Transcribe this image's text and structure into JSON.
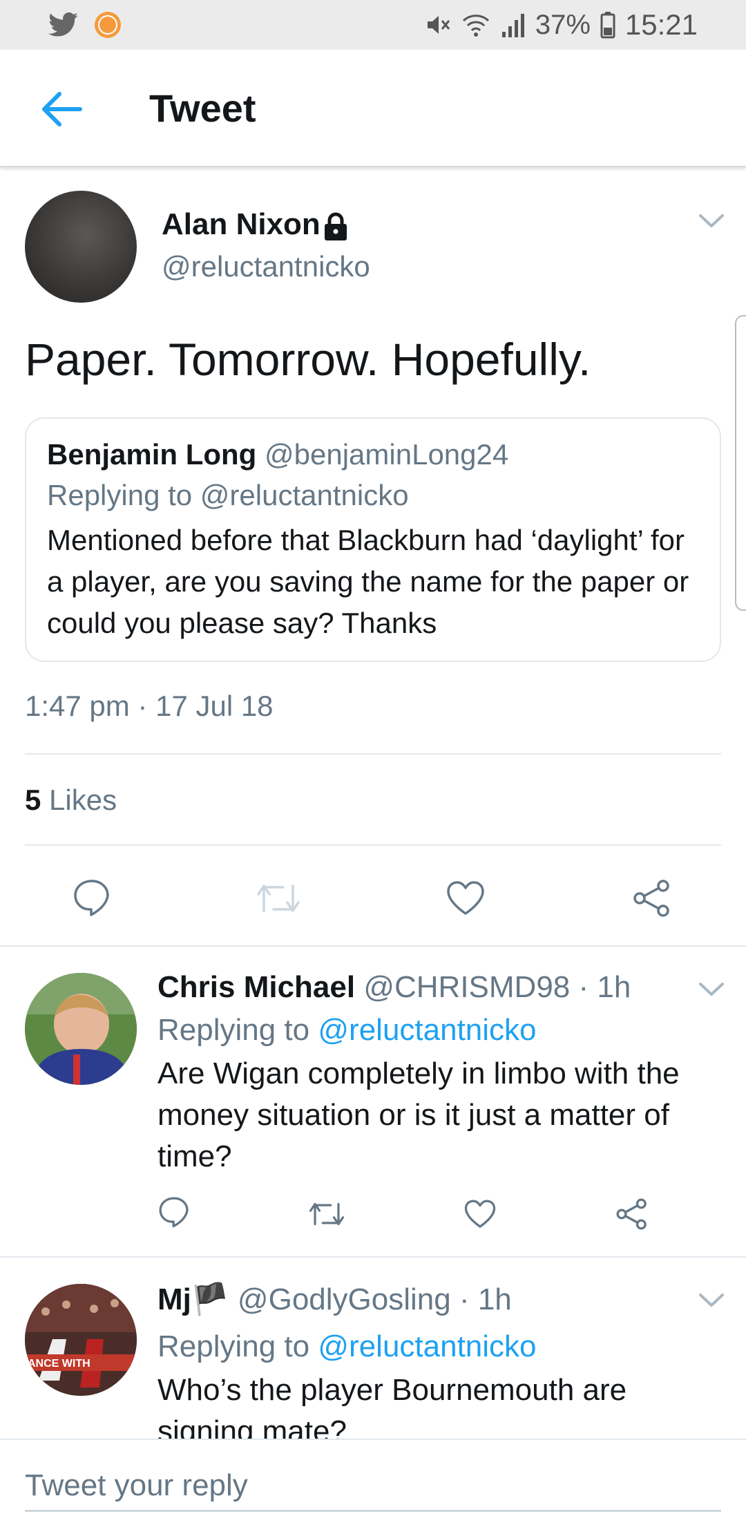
{
  "status_bar": {
    "battery": "37%",
    "time": "15:21",
    "icons": [
      "twitter-bird-icon",
      "battery-saver-icon",
      "mute-icon",
      "wifi-icon",
      "signal-icon",
      "battery-icon"
    ]
  },
  "header": {
    "title": "Tweet"
  },
  "tweet": {
    "author_name": "Alan Nixon",
    "author_handle": "@reluctantnicko",
    "text": "Paper. Tomorrow. Hopefully.",
    "quote": {
      "name": "Benjamin Long",
      "handle": "@benjaminLong24",
      "replying_to": "Replying to @reluctantnicko",
      "text": "Mentioned before that Blackburn had ‘daylight’ for a player, are you saving the name for the paper or could you please say? Thanks"
    },
    "time": "1:47 pm · 17 Jul 18",
    "likes_count": "5",
    "likes_label": "Likes"
  },
  "replies": [
    {
      "name": "Chris Michael",
      "meta": "@CHRISMD98 · 1h",
      "replying_prefix": "Replying to",
      "replying_mention": "@reluctantnicko",
      "text": "Are Wigan completely in limbo with the money situation or is it just a matter of time?"
    },
    {
      "name": "Mj",
      "flag": "🏴",
      "meta": "@GodlyGosling · 1h",
      "replying_prefix": "Replying to",
      "replying_mention": "@reluctantnicko",
      "text": "Who’s the player Bournemouth are signing mate?",
      "avatar_text": "ANCE WITH"
    }
  ],
  "compose": {
    "placeholder": "Tweet your reply"
  },
  "colors": {
    "accent": "#1da1f2",
    "secondary_text": "#657786",
    "divider": "#e1e8ed"
  }
}
